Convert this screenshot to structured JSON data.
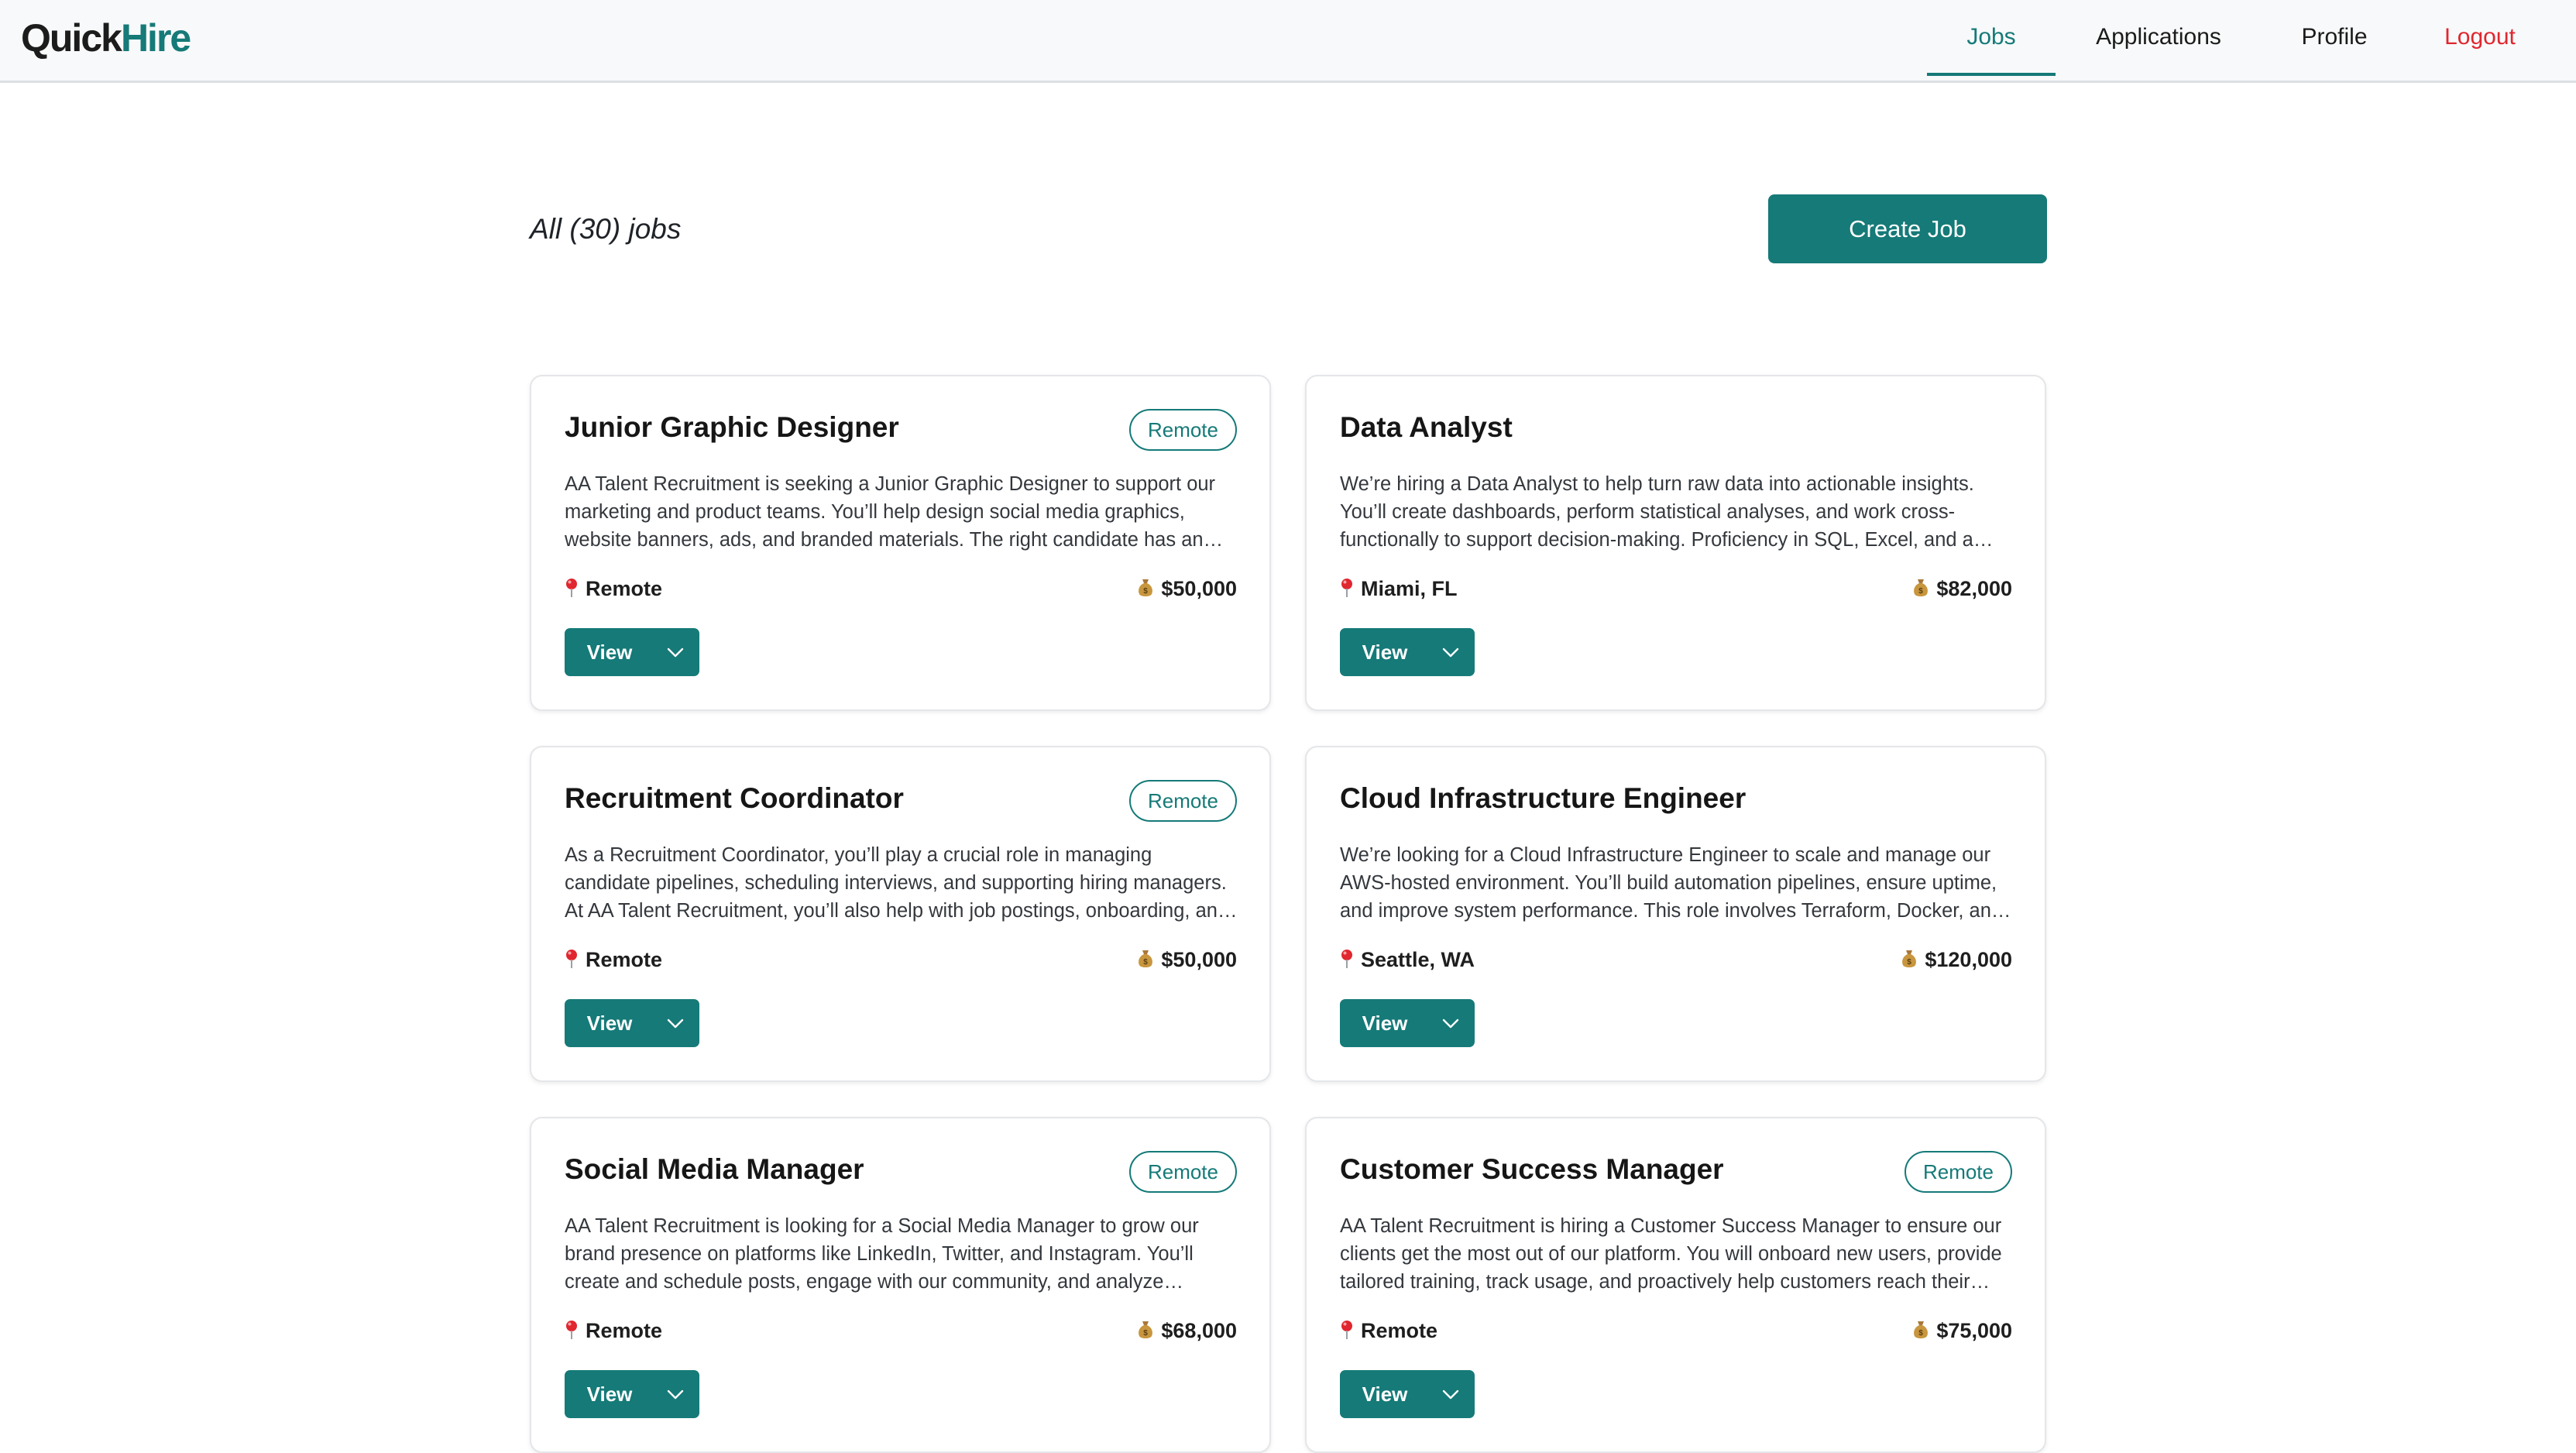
{
  "app": {
    "logo_part1": "Quick",
    "logo_part2": "Hire"
  },
  "nav": {
    "jobs": "Jobs",
    "applications": "Applications",
    "profile": "Profile",
    "logout": "Logout"
  },
  "page": {
    "title": "All (30) jobs",
    "create_button": "Create Job"
  },
  "jobs": [
    {
      "title": "Junior Graphic Designer",
      "badge": "Remote",
      "description": "AA Talent Recruitment is seeking a Junior Graphic Designer to support our marketing and product teams. You’ll help design social media graphics, website banners, ads, and branded materials. The right candidate has an eye for detail and a passion for visual storytelling.",
      "location": "Remote",
      "salary": "$50,000",
      "view_label": "View"
    },
    {
      "title": "Data Analyst",
      "badge": "",
      "description": "We’re hiring a Data Analyst to help turn raw data into actionable insights. You’ll create dashboards, perform statistical analyses, and work cross-functionally to support decision-making. Proficiency in SQL, Excel, and a visualization tool is required.",
      "location": "Miami, FL",
      "salary": "$82,000",
      "view_label": "View"
    },
    {
      "title": "Recruitment Coordinator",
      "badge": "Remote",
      "description": "As a Recruitment Coordinator, you’ll play a crucial role in managing candidate pipelines, scheduling interviews, and supporting hiring managers. At AA Talent Recruitment, you’ll also help with job postings, onboarding, and keeping our processes running smoothly.",
      "location": "Remote",
      "salary": "$50,000",
      "view_label": "View"
    },
    {
      "title": "Cloud Infrastructure Engineer",
      "badge": "",
      "description": "We’re looking for a Cloud Infrastructure Engineer to scale and manage our AWS-hosted environment. You’ll build automation pipelines, ensure uptime, and improve system performance. This role involves Terraform, Docker, and close collaboration with our developers.",
      "location": "Seattle, WA",
      "salary": "$120,000",
      "view_label": "View"
    },
    {
      "title": "Social Media Manager",
      "badge": "Remote",
      "description": "AA Talent Recruitment is looking for a Social Media Manager to grow our brand presence on platforms like LinkedIn, Twitter, and Instagram. You’ll create and schedule posts, engage with our community, and analyze performance to refine our strategy.",
      "location": "Remote",
      "salary": "$68,000",
      "view_label": "View"
    },
    {
      "title": "Customer Success Manager",
      "badge": "Remote",
      "description": "AA Talent Recruitment is hiring a Customer Success Manager to ensure our clients get the most out of our platform. You will onboard new users, provide tailored training, track usage, and proactively help customers reach their goals.",
      "location": "Remote",
      "salary": "$75,000",
      "view_label": "View"
    }
  ],
  "icons": {
    "location": "map-pin-icon",
    "salary": "money-bag-icon",
    "dropdown": "chevron-down-icon"
  },
  "colors": {
    "brand": "#157a78",
    "logout": "#e0262f",
    "pin": "#e0262f",
    "money_bag": "#c8963e"
  }
}
